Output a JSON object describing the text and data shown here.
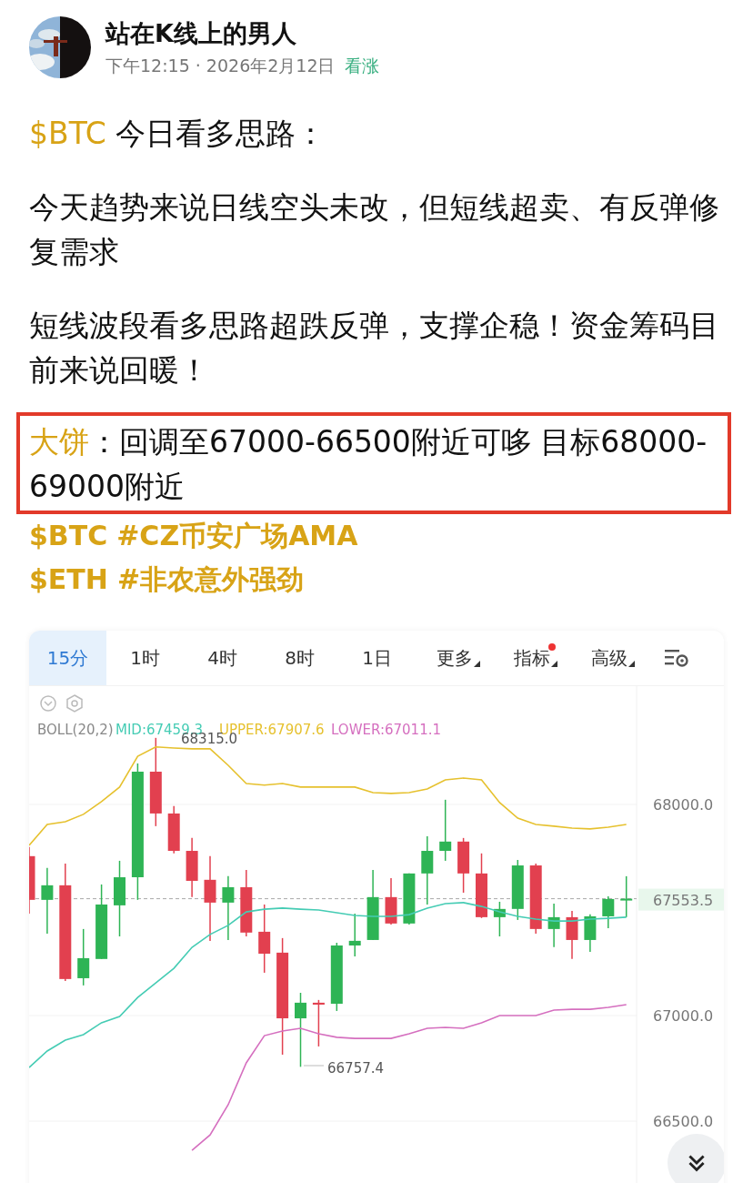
{
  "author": {
    "name": "站在K线上的男人",
    "time": "下午12:15 · 2026年2月12日",
    "sentiment": "看涨"
  },
  "post": {
    "intro": {
      "tag": "$BTC",
      "text": " 今日看多思路："
    },
    "paragraphs": [
      "今天趋势来说日线空头未改，但短线超卖、有反弹修复需求",
      "短线波段看多思路超跌反弹，支撑企稳！资金筹码目前来说回暖！"
    ],
    "plan": {
      "lead": "大饼",
      "text": "：回调至67000-66500附近可哆 目标68000-69000附近"
    },
    "tag_lines": [
      [
        "$BTC",
        "#CZ币安广场AMA"
      ],
      [
        "$ETH",
        "#非农意外强劲"
      ]
    ]
  },
  "chart": {
    "tabs": [
      {
        "label": "15分",
        "selected": true,
        "caret": false,
        "dot": false
      },
      {
        "label": "1时",
        "selected": false,
        "caret": false,
        "dot": false
      },
      {
        "label": "4时",
        "selected": false,
        "caret": false,
        "dot": false
      },
      {
        "label": "8时",
        "selected": false,
        "caret": false,
        "dot": false
      },
      {
        "label": "1日",
        "selected": false,
        "caret": false,
        "dot": false
      },
      {
        "label": "更多",
        "selected": false,
        "caret": true,
        "dot": false
      },
      {
        "label": "指标",
        "selected": false,
        "caret": true,
        "dot": true
      },
      {
        "label": "高级",
        "selected": false,
        "caret": true,
        "dot": false
      }
    ],
    "indicator": {
      "name": "BOLL(20,2)"
    },
    "chart_data": {
      "type": "candlestick",
      "ylim": [
        66203,
        68560
      ],
      "grid": true,
      "ohlc": [
        [
          67755,
          67798,
          67483,
          67548
        ],
        [
          67548,
          67699,
          67388,
          67617
        ],
        [
          67617,
          67720,
          67164,
          67173
        ],
        [
          67177,
          67410,
          67143,
          67272
        ],
        [
          67268,
          67621,
          67268,
          67526
        ],
        [
          67522,
          67733,
          67375,
          67655
        ],
        [
          67655,
          68194,
          67548,
          68155
        ],
        [
          68155,
          68315,
          67897,
          67957
        ],
        [
          67957,
          67992,
          67768,
          67780
        ],
        [
          67780,
          67841,
          67561,
          67638
        ],
        [
          67643,
          67755,
          67354,
          67535
        ],
        [
          67535,
          67660,
          67358,
          67608
        ],
        [
          67608,
          67690,
          67375,
          67393
        ],
        [
          67397,
          67526,
          67203,
          67293
        ],
        [
          67298,
          67367,
          66815,
          66987
        ],
        [
          66987,
          67108,
          66757.4,
          67061
        ],
        [
          67061,
          67074,
          66854,
          67052
        ],
        [
          67056,
          67345,
          67022,
          67332
        ],
        [
          67332,
          67483,
          67280,
          67354
        ],
        [
          67358,
          67690,
          67358,
          67561
        ],
        [
          67561,
          67651,
          67431,
          67436
        ],
        [
          67436,
          67673,
          67431,
          67673
        ],
        [
          67673,
          67849,
          67526,
          67780
        ],
        [
          67780,
          68022,
          67733,
          67824
        ],
        [
          67824,
          67841,
          67582,
          67673
        ],
        [
          67673,
          67768,
          67462,
          67466
        ],
        [
          67466,
          67539,
          67375,
          67505
        ],
        [
          67505,
          67737,
          67453,
          67711
        ],
        [
          67711,
          67720,
          67388,
          67410
        ],
        [
          67410,
          67530,
          67324,
          67466
        ],
        [
          67466,
          67496,
          67268,
          67358
        ],
        [
          67358,
          67479,
          67302,
          67470
        ],
        [
          67470,
          67565,
          67414,
          67552
        ],
        [
          67548,
          67660,
          67466,
          67553.5
        ]
      ],
      "ref_lines": [
        {
          "axis": "y",
          "value": 67553.5,
          "label": "67553.5"
        }
      ],
      "yticks": [
        {
          "value": 68000,
          "label": "68000.0"
        },
        {
          "value": 67000,
          "label": "67000.0"
        },
        {
          "value": 66500,
          "label": "66500.0"
        }
      ],
      "series": [
        {
          "name": "MID:67459.3",
          "type": "line",
          "color": "#45ccb4",
          "values": [
            66754,
            66832,
            66884,
            66910,
            66966,
            66996,
            67086,
            67155,
            67224,
            67323,
            67384,
            67427,
            67491,
            67504,
            67509,
            67504,
            67500,
            67487,
            67474,
            67470,
            67470,
            67478,
            67509,
            67530,
            67535,
            67517,
            67491,
            67470,
            67457,
            67448,
            67448,
            67457,
            67461,
            67466
          ]
        },
        {
          "name": "UPPER:67907.6",
          "type": "line",
          "color": "#e6c12e",
          "values": [
            67806,
            67905,
            67918,
            67953,
            68013,
            68082,
            68228,
            68272,
            68267,
            68263,
            68263,
            68185,
            68099,
            68091,
            68099,
            68082,
            68082,
            68082,
            68082,
            68056,
            68052,
            68056,
            68073,
            68116,
            68125,
            68116,
            68009,
            67935,
            67905,
            67897,
            67888,
            67884,
            67892,
            67905
          ]
        },
        {
          "name": "LOWER:67011.1",
          "type": "line",
          "color": "#d56fbf",
          "values": [
            null,
            null,
            null,
            null,
            null,
            null,
            null,
            null,
            null,
            66362,
            66435,
            66578,
            66776,
            66905,
            66927,
            66940,
            66914,
            66897,
            66892,
            66892,
            66892,
            66914,
            66940,
            66944,
            66940,
            66966,
            67000,
            67000,
            67000,
            67026,
            67030,
            67030,
            67039,
            67052
          ]
        }
      ]
    },
    "high_mark": "68315.0",
    "low_mark": "66757.4"
  }
}
